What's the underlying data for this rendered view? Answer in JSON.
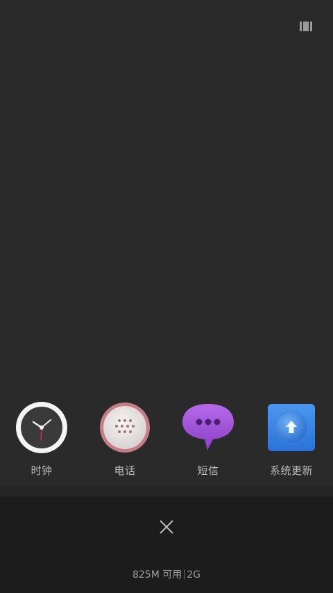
{
  "top_bar": {
    "view_toggle_icon": "task-view-toggle-icon"
  },
  "recent_apps": [
    {
      "label": "时钟",
      "icon": "clock-icon"
    },
    {
      "label": "电话",
      "icon": "phone-dialpad-icon"
    },
    {
      "label": "短信",
      "icon": "message-bubble-icon"
    },
    {
      "label": "系统更新",
      "icon": "system-update-icon"
    }
  ],
  "bottom_panel": {
    "close_icon": "close-icon",
    "memory_available": "825M 可用",
    "memory_total": "2G"
  },
  "colors": {
    "background": "#2a2a2a",
    "bottom_panel": "#1c1c1c",
    "message_purple": "#9b4fd6",
    "update_blue": "#2f7fe6",
    "phone_pink": "#c47f86"
  }
}
